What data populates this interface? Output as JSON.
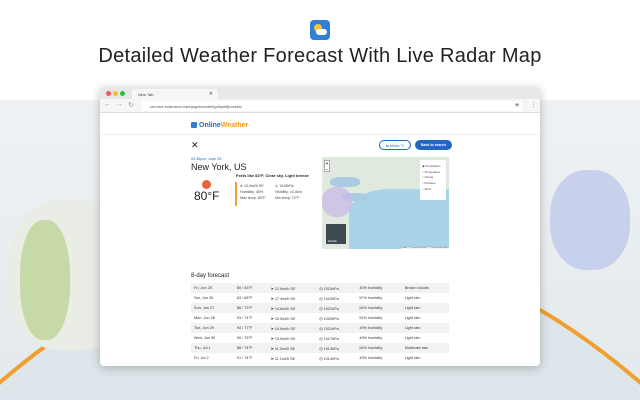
{
  "headline": "Detailed Weather Forecast With Live Radar Map",
  "browser": {
    "tab_title": "New Tab",
    "url": "chrome-extension://achjagcbmedeblgdbpelfjbcebkk/"
  },
  "app": {
    "brand_a": "Online",
    "brand_b": "Weather",
    "units_button": "⇆ Metric °C",
    "search_button": "Back to search"
  },
  "current": {
    "date": "02:46pm, June 25",
    "city": "New York, US",
    "temp": "80°F",
    "summary": "Feels like 83°F. Clear sky. Light breeze",
    "wind": "➤ 10.0mi/h SE",
    "pressure": "◎ 1015hPa",
    "humidity": "Humidity: 46%",
    "visibility": "Visibility: 10.0km",
    "max": "Max temp: 85°F",
    "min": "Min temp: 72°F"
  },
  "map": {
    "layers": [
      "Precipitation",
      "Temperature",
      "Clouds",
      "Pressure",
      "Wind"
    ],
    "selected": "Precipitation",
    "attribution": "Leaflet | © OpenStreetMap, © OpenWeatherMap",
    "mini_label": "Satellite"
  },
  "forecast": {
    "title": "8-day forecast",
    "rows": [
      [
        "Fri, Jun 25",
        "80 / 63°F",
        "12.0mi/h SE",
        "1015hPa",
        "40% humidity",
        "Broken clouds"
      ],
      [
        "Sat, Jun 26",
        "83 / 68°F",
        "17.4mi/h SE",
        "1015hPa",
        "57% humidity",
        "Light rain"
      ],
      [
        "Sun, Jun 27",
        "88 / 73°F",
        "14.6mi/h SE",
        "1022hPa",
        "54% humidity",
        "Light rain"
      ],
      [
        "Mon, Jun 28",
        "93 / 74°F",
        "10.5mi/h SE",
        "1020hPa",
        "51% humidity",
        "Light rain"
      ],
      [
        "Tue, Jun 29",
        "94 / 77°F",
        "14.0mi/h SE",
        "1021hPa",
        "49% humidity",
        "Light rain"
      ],
      [
        "Wed, Jun 30",
        "90 / 75°F",
        "13.0mi/h SE",
        "1017hPa",
        "49% humidity",
        "Light rain"
      ],
      [
        "Thu, Jul 1",
        "88 / 74°F",
        "11.3mi/h SE",
        "1013hPa",
        "54% humidity",
        "Moderate rain"
      ],
      [
        "Fri, Jul 2",
        "91 / 74°F",
        "11.1mi/h SE",
        "1014hPa",
        "49% humidity",
        "Light rain"
      ]
    ]
  }
}
